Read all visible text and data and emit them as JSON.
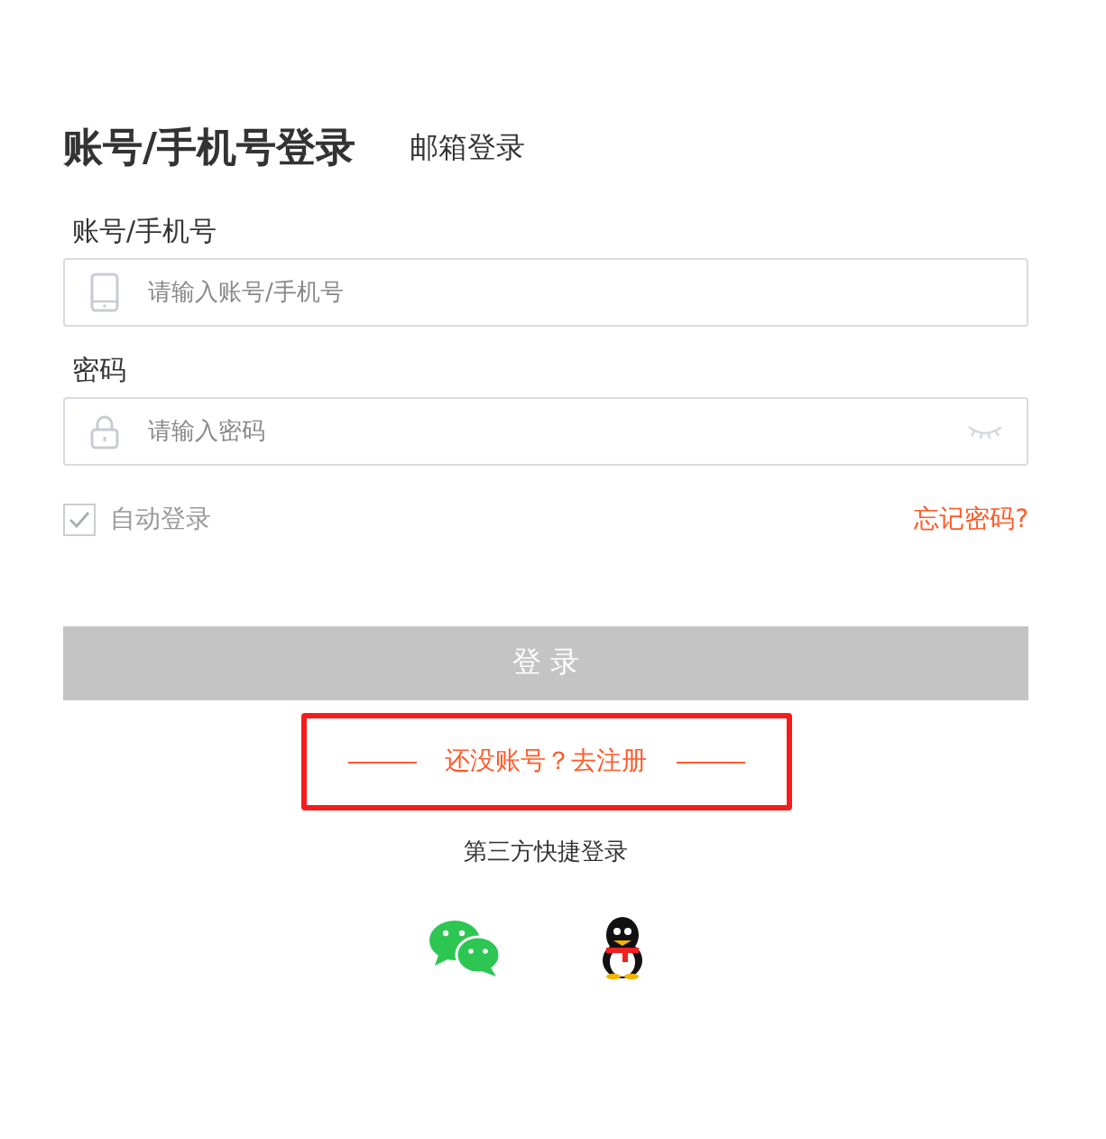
{
  "tabs": [
    {
      "label": "账号/手机号登录",
      "selected": true
    },
    {
      "label": "邮箱登录",
      "selected": false
    }
  ],
  "fields": [
    {
      "label": "账号/手机号",
      "placeholder": "请输入账号/手机号",
      "kind": "phone"
    },
    {
      "label": "密码",
      "placeholder": "请输入密码",
      "kind": "password"
    }
  ],
  "auto_login": {
    "label": "自动登录",
    "checked": true
  },
  "forgot_link": "忘记密码?",
  "login_button": {
    "label": "登 录",
    "disabled": true
  },
  "register": {
    "label": "还没账号？去注册",
    "highlighted": true
  },
  "third_party": {
    "title": "第三方快捷登录",
    "providers": [
      {
        "kind": "chat"
      },
      {
        "kind": "penguin"
      }
    ]
  }
}
